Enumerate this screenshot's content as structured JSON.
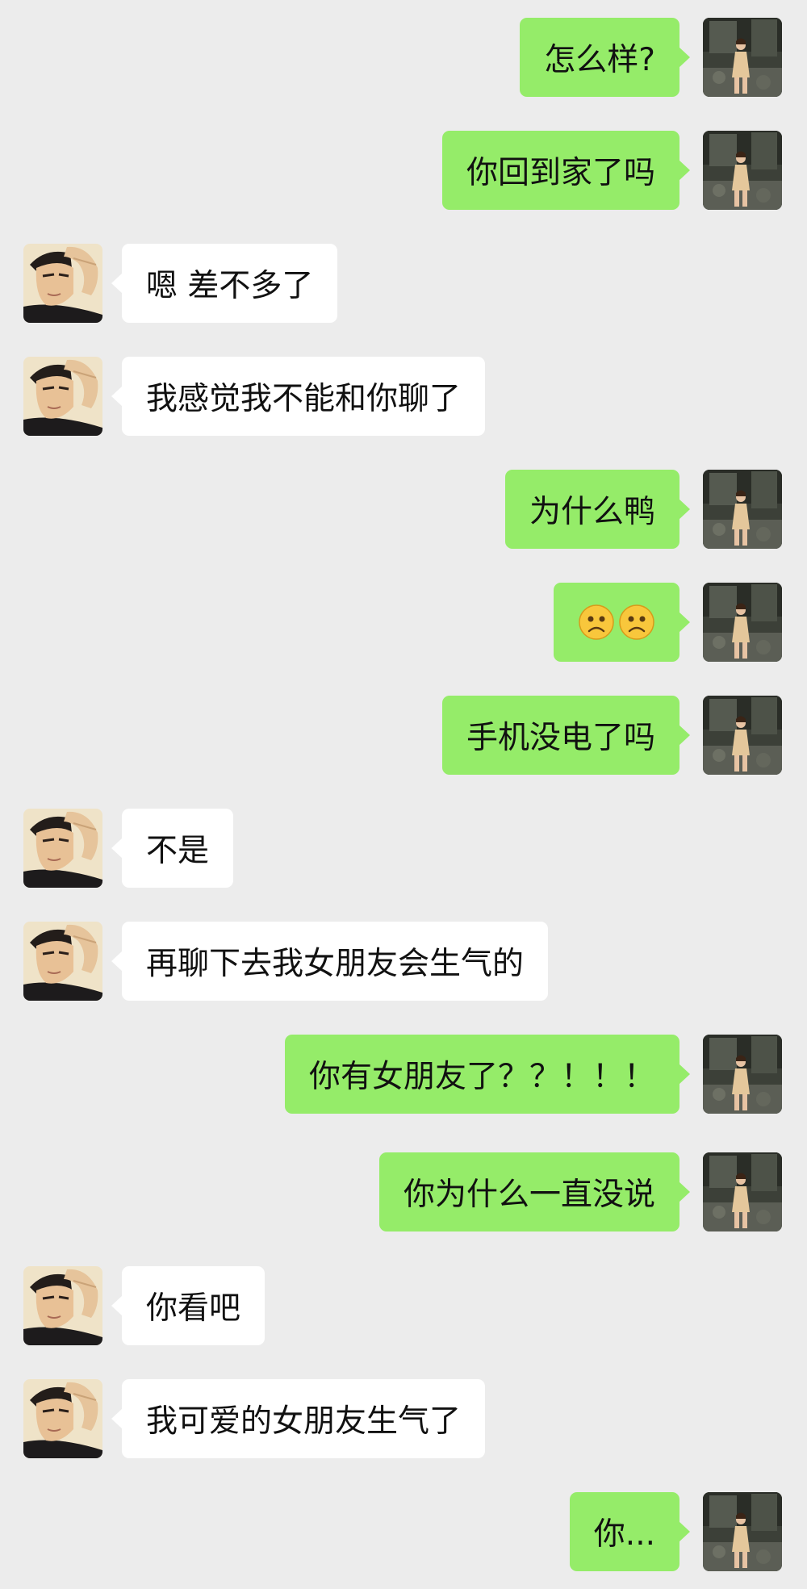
{
  "colors": {
    "background": "#ececec",
    "outgoing_bubble": "#95ec69",
    "incoming_bubble": "#ffffff",
    "text": "#111111"
  },
  "avatars": {
    "me": "avatar-woman-standing-photo",
    "them": "avatar-young-man-hand-on-forehead"
  },
  "messages": [
    {
      "side": "me",
      "text": "怎么样?"
    },
    {
      "side": "me",
      "text": "你回到家了吗"
    },
    {
      "side": "them",
      "text": "嗯 差不多了"
    },
    {
      "side": "them",
      "text": "我感觉我不能和你聊了"
    },
    {
      "side": "me",
      "text": "为什么鸭"
    },
    {
      "side": "me",
      "text": "",
      "emoji": [
        "frowning-face-icon",
        "frowning-face-icon"
      ]
    },
    {
      "side": "me",
      "text": "手机没电了吗"
    },
    {
      "side": "them",
      "text": "不是"
    },
    {
      "side": "them",
      "text": "再聊下去我女朋友会生气的"
    },
    {
      "side": "me",
      "text": "你有女朋友了？？！！！"
    },
    {
      "side": "me",
      "text": "你为什么一直没说"
    },
    {
      "side": "them",
      "text": "你看吧"
    },
    {
      "side": "them",
      "text": "我可爱的女朋友生气了"
    },
    {
      "side": "me",
      "text": "你..."
    }
  ]
}
